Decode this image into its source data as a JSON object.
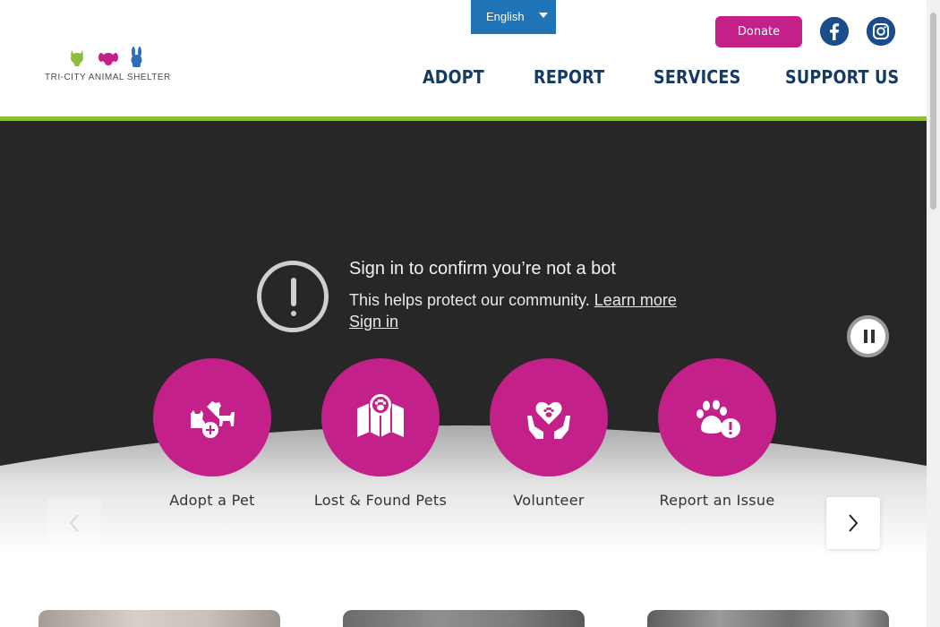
{
  "header": {
    "logo_text": "TRI-CITY  ANIMAL  SHELTER",
    "language": "English",
    "donate_label": "Donate",
    "social": [
      "facebook-icon",
      "instagram-icon"
    ],
    "nav": [
      "ADOPT",
      "REPORT",
      "SERVICES",
      "SUPPORT US"
    ]
  },
  "hero": {
    "bot_title": "Sign in to confirm you’re not a bot",
    "bot_sub": "This helps protect our community.",
    "learn_more": "Learn more",
    "sign_in": "Sign in"
  },
  "quick_links": [
    {
      "label": "Adopt a Pet",
      "icon": "pets-adopt-icon"
    },
    {
      "label": "Lost & Found Pets",
      "icon": "map-paw-icon"
    },
    {
      "label": "Volunteer",
      "icon": "heart-hands-icon"
    },
    {
      "label": "Report an Issue",
      "icon": "paw-alert-icon"
    }
  ],
  "colors": {
    "brand_magenta": "#c4208a",
    "nav_navy": "#153b63",
    "accent_green": "#8dbd3a",
    "language_blue": "#1f74b8",
    "hero_dark": "#272727"
  }
}
